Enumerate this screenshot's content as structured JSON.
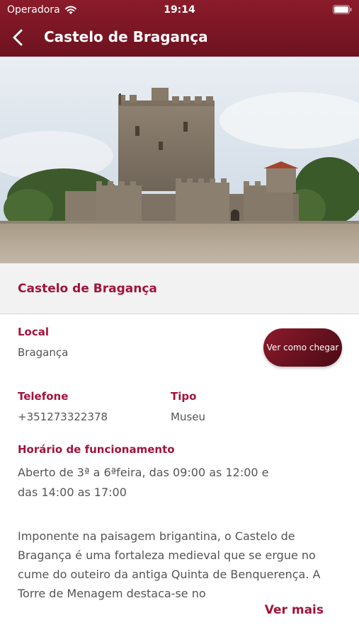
{
  "status": {
    "carrier": "Operadora",
    "time": "19:14"
  },
  "header": {
    "title": "Castelo de Bragança"
  },
  "place": {
    "name": "Castelo de Bragança"
  },
  "local": {
    "label": "Local",
    "value": "Bragança"
  },
  "route_button": {
    "label": "Ver como chegar"
  },
  "phone": {
    "label": "Telefone",
    "value": "+351273322378"
  },
  "type": {
    "label": "Tipo",
    "value": "Museu"
  },
  "hours": {
    "label": "Horário de funcionamento",
    "value": "Aberto de 3ª a 6ªfeira, das 09:00 as 12:00 e das 14:00 as 17:00"
  },
  "description": {
    "text": "Imponente na paisagem brigantina, o Castelo de Bragança é uma fortaleza medieval que se ergue no cume do outeiro da antiga Quinta de Benquerença. A Torre de Menagem destaca-se no",
    "more_label": "Ver mais"
  },
  "colors": {
    "accent": "#a0143a",
    "header": "#7a1524"
  }
}
